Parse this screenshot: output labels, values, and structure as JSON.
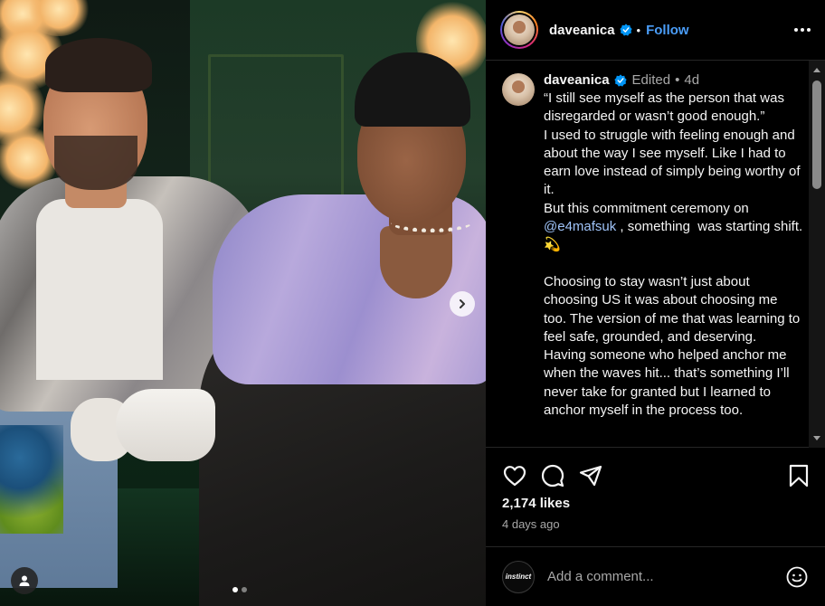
{
  "post": {
    "username": "daveanica",
    "follow_label": "Follow",
    "separator": "•"
  },
  "media": {
    "slides_total": 2,
    "active_slide": 1,
    "carousel_next_icon": "chevron-right-icon",
    "tag_icon": "user-tag-icon"
  },
  "caption": {
    "username": "daveanica",
    "edited_label": "Edited",
    "separator": "•",
    "age": "4d",
    "text_part1": "“I still see myself as the person that was disregarded or wasn’t good enough.”\nI used to struggle with feeling enough and about the way I see myself. Like I had to earn love instead of simply being worthy of it.\nBut this commitment ceremony on\n",
    "mention": "@e4mafsuk",
    "text_part2": " , something  was starting shift. 💫\n\nChoosing to stay wasn’t just about choosing US it was about choosing me too. The version of me that was learning to feel safe, grounded, and deserving.\nHaving someone who helped anchor me when the waves hit... that’s something I’ll never take for granted but I learned to anchor myself in the process too."
  },
  "actions": {
    "like_icon": "heart-icon",
    "comment_icon": "comment-icon",
    "share_icon": "send-icon",
    "save_icon": "bookmark-icon"
  },
  "stats": {
    "likes": "2,174 likes",
    "time_ago": "4 days ago"
  },
  "comment_box": {
    "avatar_label": "instinct",
    "placeholder": "Add a comment...",
    "emoji_icon": "emoji-icon"
  },
  "colors": {
    "accent_link": "#4a9df8",
    "verified": "#0095f6",
    "mention": "#9fc3f8",
    "muted": "#a8a8a8"
  }
}
